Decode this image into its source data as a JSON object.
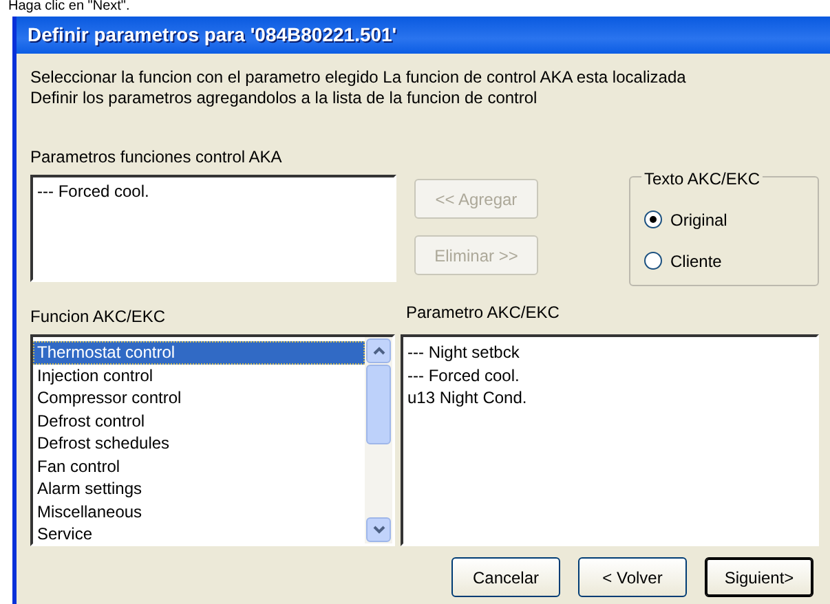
{
  "background_text": "Haga clic en \"Next\".",
  "window": {
    "title": "Definir parametros para '084B80221.501'"
  },
  "instructions": [
    "Seleccionar la funcion con el parametro elegido La funcion de control AKA esta localizada",
    "Definir los parametros agregandolos a la lista de la funcion de control"
  ],
  "aka_parameters": {
    "label": "Parametros funciones control AKA",
    "items": [
      "--- Forced cool."
    ]
  },
  "move_buttons": [
    {
      "label": "<< Agregar",
      "disabled": true
    },
    {
      "label": "Eliminar >>",
      "disabled": true
    }
  ],
  "text_group": {
    "title": "Texto AKC/EKC",
    "options": [
      {
        "label": "Original",
        "selected": true
      },
      {
        "label": "Cliente",
        "selected": false
      }
    ]
  },
  "functions": {
    "label": "Funcion AKC/EKC",
    "items": [
      {
        "label": "Thermostat control",
        "selected": true
      },
      {
        "label": "Injection control",
        "selected": false
      },
      {
        "label": "Compressor control",
        "selected": false
      },
      {
        "label": "Defrost control",
        "selected": false
      },
      {
        "label": "Defrost schedules",
        "selected": false
      },
      {
        "label": "Fan control",
        "selected": false
      },
      {
        "label": "Alarm settings",
        "selected": false
      },
      {
        "label": "Miscellaneous",
        "selected": false
      },
      {
        "label": "Service",
        "selected": false
      }
    ]
  },
  "parameters": {
    "label": "Parametro AKC/EKC",
    "items": [
      "--- Night setbck",
      "--- Forced cool.",
      "u13 Night Cond."
    ]
  },
  "buttons": [
    {
      "label": "Cancelar",
      "default": false
    },
    {
      "label": "< Volver",
      "default": false
    },
    {
      "label": "Siguient>",
      "default": true
    }
  ]
}
